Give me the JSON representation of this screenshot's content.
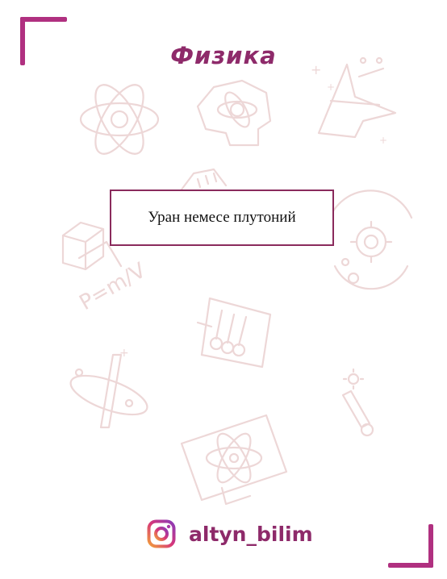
{
  "header": {
    "title": "Физика"
  },
  "card": {
    "text": "Уран немесе плутоний"
  },
  "footer": {
    "handle": "altyn_bilim",
    "icon": "instagram-icon"
  },
  "colors": {
    "accent": "#b03080",
    "title": "#8e2a6a",
    "box_border": "#8a2a5c",
    "doodle": "#edd7d7"
  }
}
